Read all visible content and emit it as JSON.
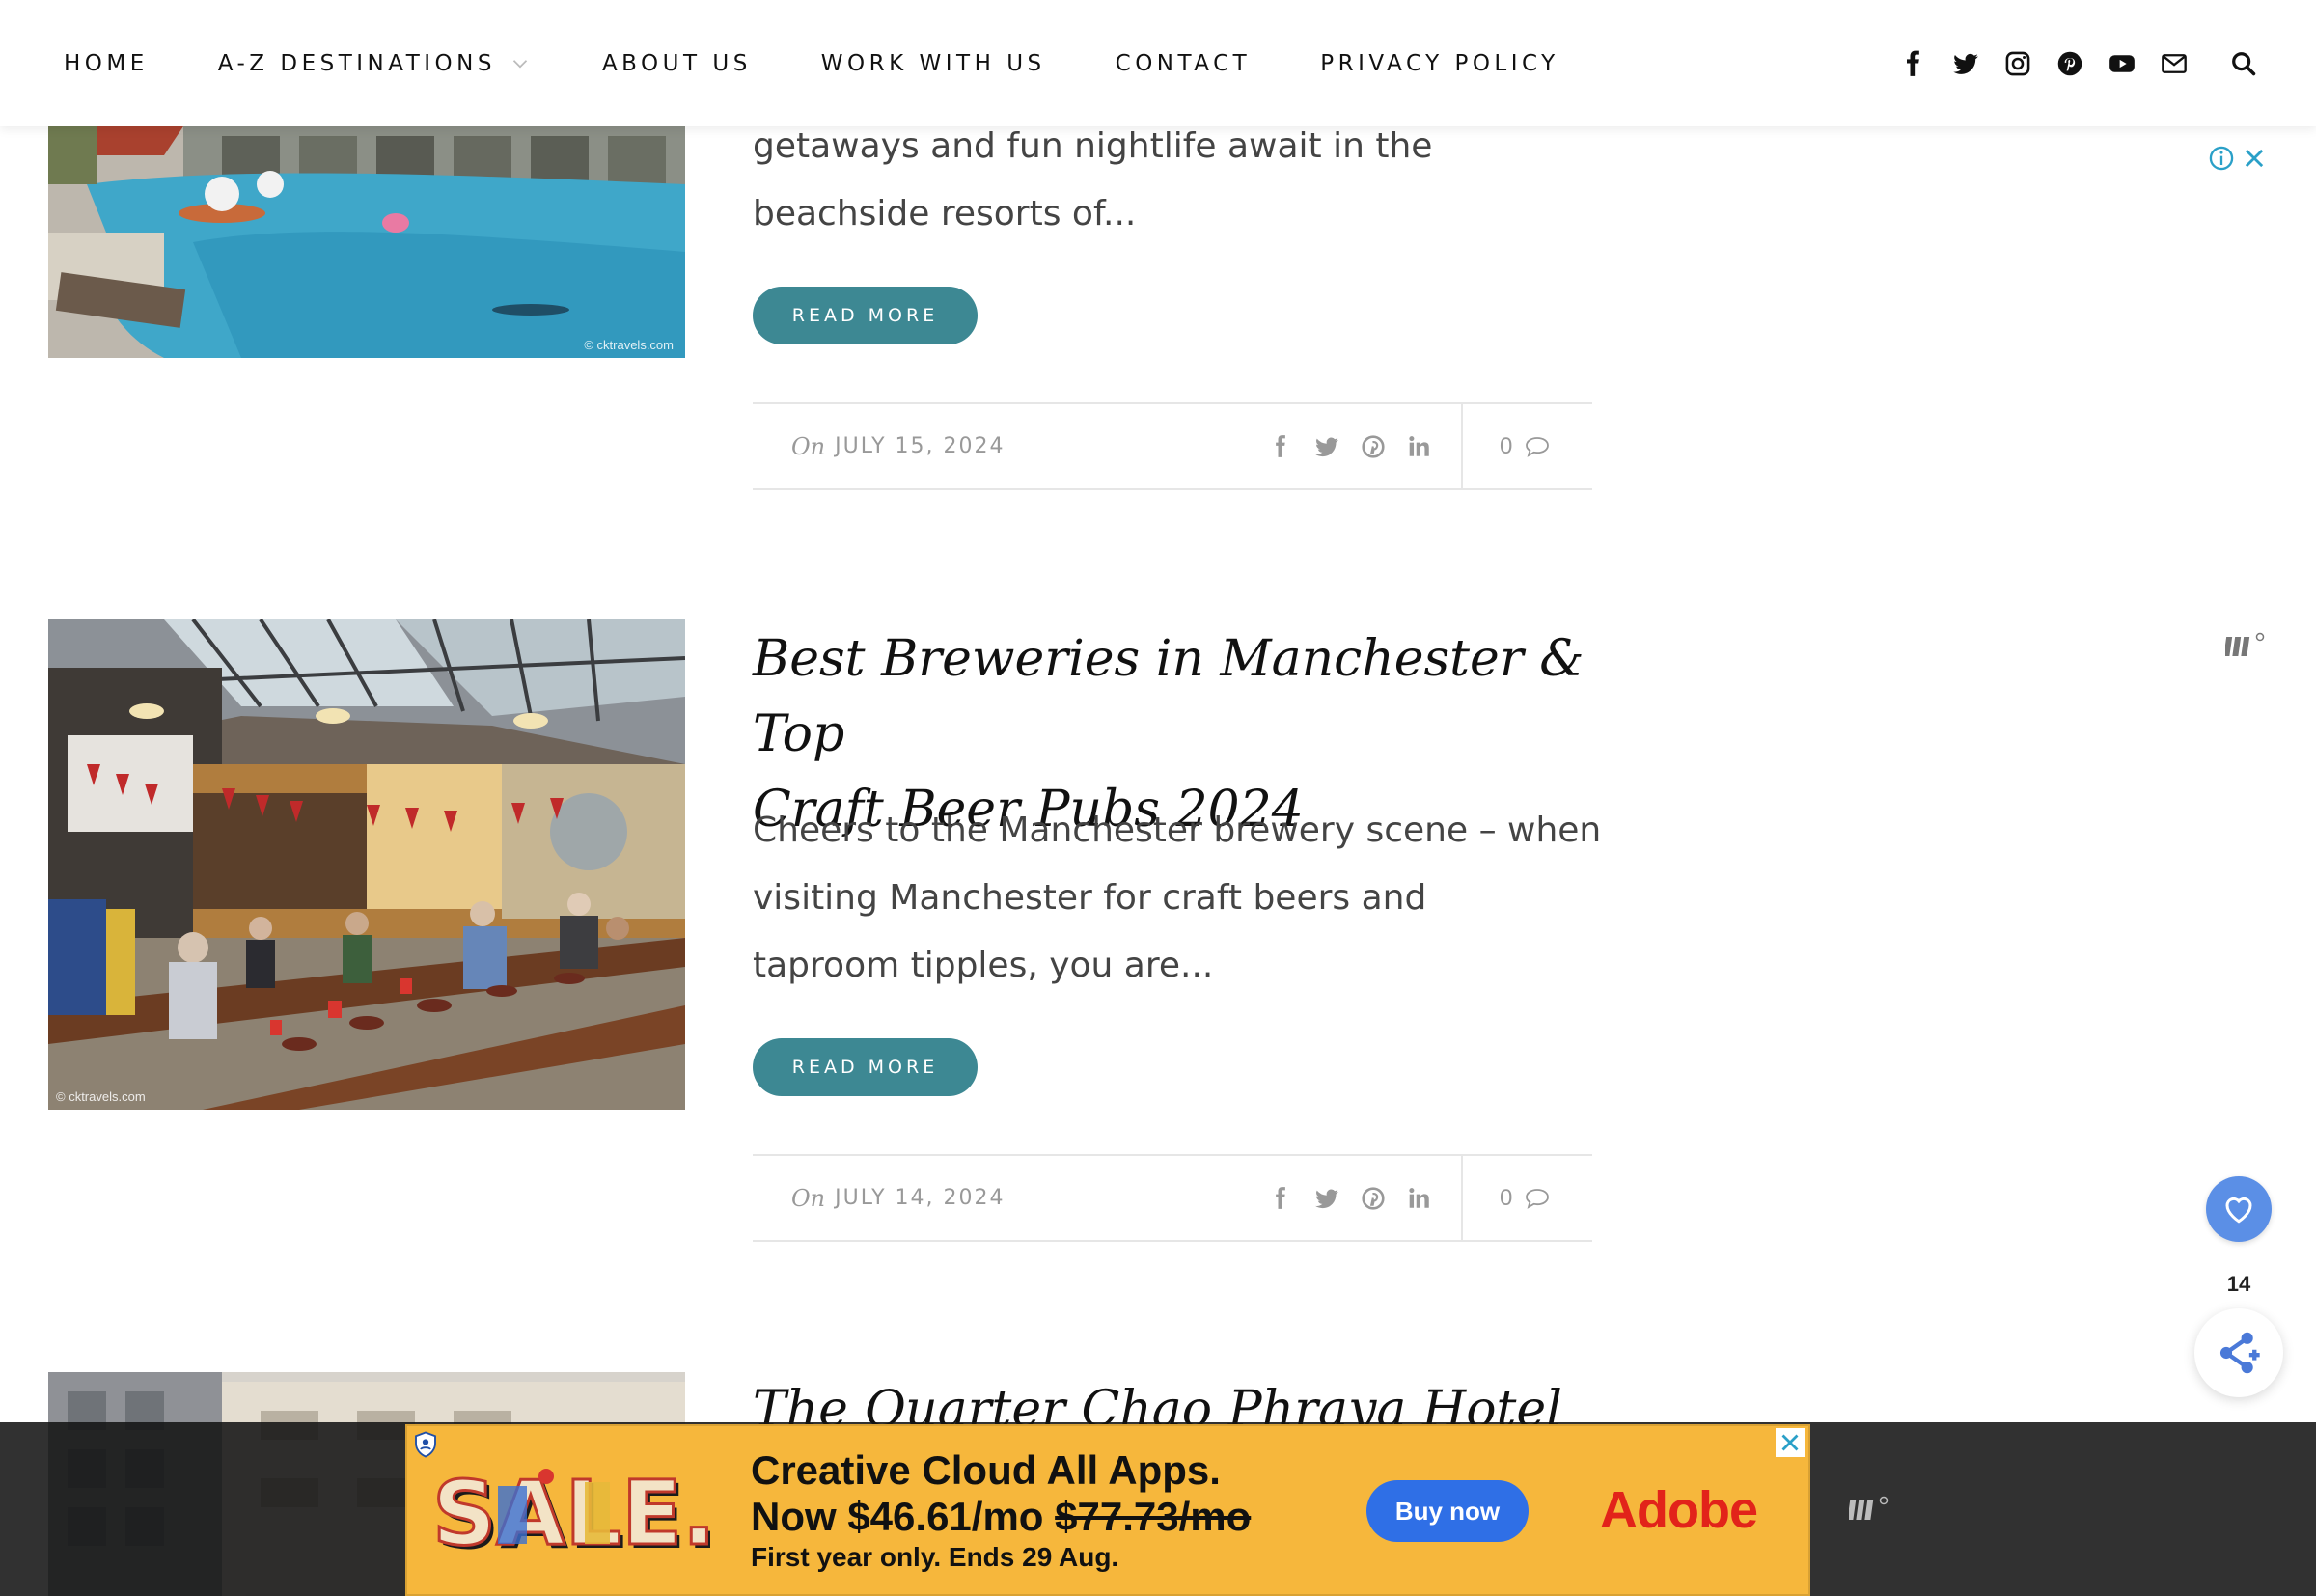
{
  "nav": {
    "items": [
      {
        "label": "HOME"
      },
      {
        "label": "A-Z DESTINATIONS",
        "has_dropdown": true
      },
      {
        "label": "ABOUT US"
      },
      {
        "label": "WORK WITH US"
      },
      {
        "label": "CONTACT"
      },
      {
        "label": "PRIVACY POLICY"
      }
    ],
    "social_icons": [
      "facebook-icon",
      "twitter-icon",
      "instagram-icon",
      "pinterest-icon",
      "youtube-icon",
      "mail-icon"
    ],
    "search_icon": "search-icon"
  },
  "posts": [
    {
      "excerpt_lines": [
        "getaways and fun nightlife await in the",
        "beachside resorts of..."
      ],
      "image_credit": "© cktravels.com",
      "read_more": "READ MORE",
      "date_prefix": "On",
      "date": "JULY 15, 2024",
      "comment_count": "0"
    },
    {
      "title_lines": [
        "Best Breweries in Manchester & Top",
        "Craft Beer Pubs 2024"
      ],
      "excerpt_lines": [
        "Cheers to the Manchester brewery scene – when",
        "visiting Manchester for craft beers and",
        "taproom tipples, you are..."
      ],
      "image_credit": "© cktravels.com",
      "read_more": "READ MORE",
      "date_prefix": "On",
      "date": "JULY 14, 2024",
      "comment_count": "0"
    },
    {
      "title_lines": [
        "The Quarter Chao Phraya Hotel"
      ]
    }
  ],
  "share_widget": {
    "count": "14"
  },
  "colors": {
    "accent": "#3d8893",
    "share_blue": "#5b8fe6",
    "ad_bg": "#f6b73c",
    "adobe_red": "#e2231a",
    "buy_blue": "#2f6fe6"
  },
  "ad": {
    "sale_word": "SALE.",
    "headline_line1": "Creative Cloud All Apps.",
    "headline_price": "Now $46.61/mo",
    "headline_old_price": "$77.73/mo",
    "subline": "First year only. Ends 29 Aug.",
    "button": "Buy now",
    "brand": "Adobe"
  }
}
